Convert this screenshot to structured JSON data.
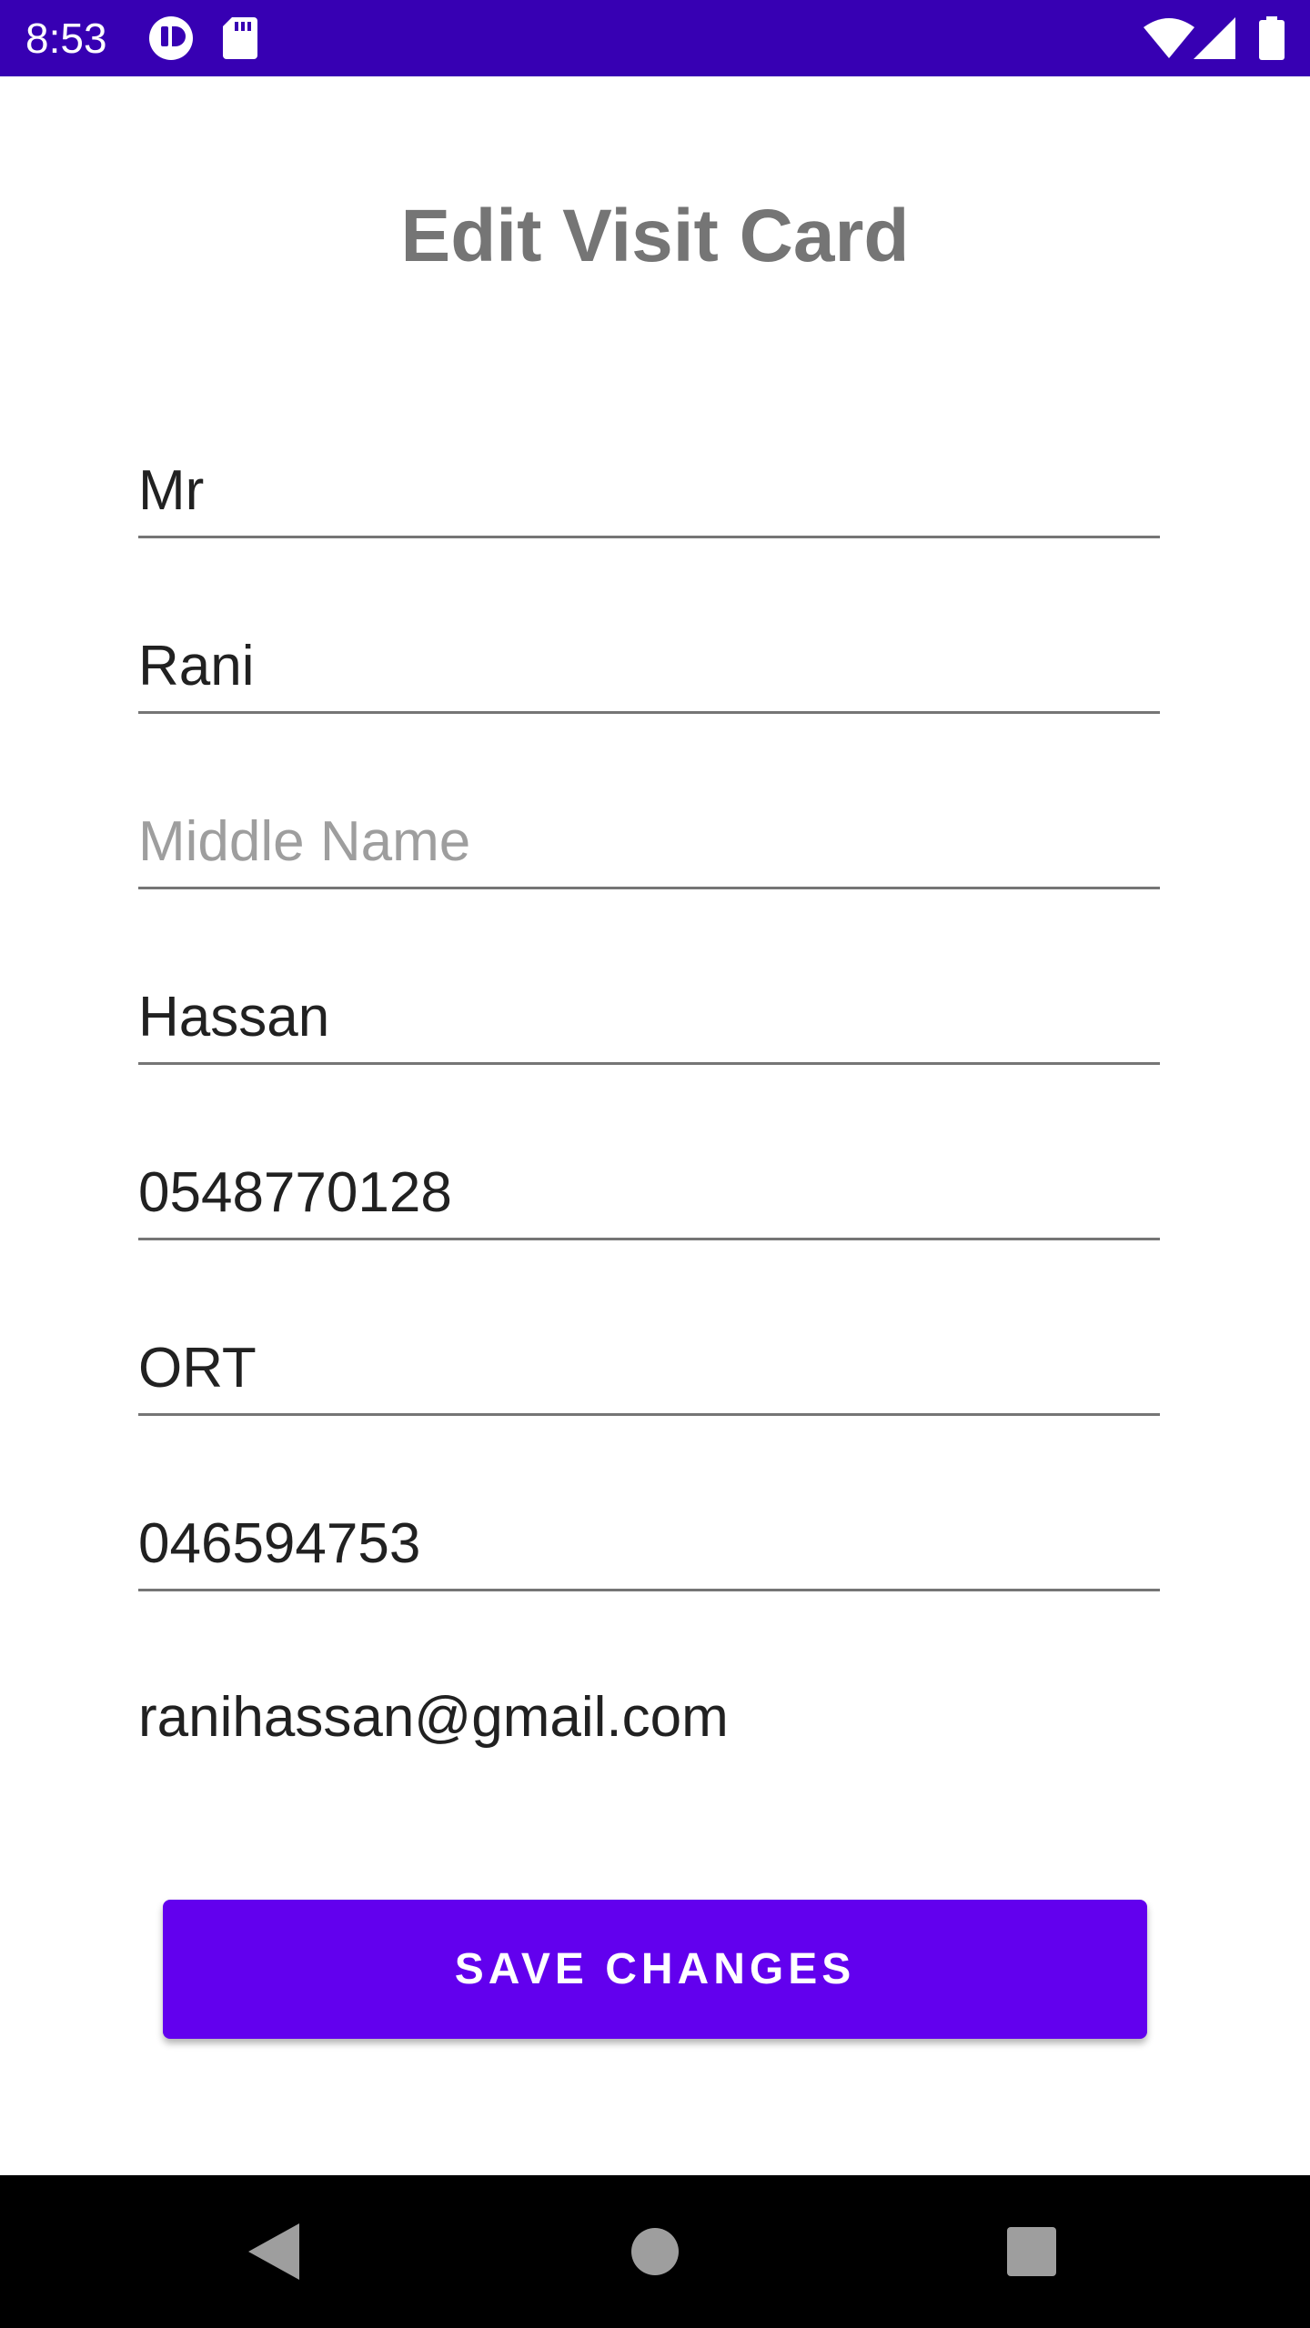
{
  "status_bar": {
    "time": "8:53",
    "background": "#3700b3",
    "icons": [
      "notification-app-icon",
      "sd-card-icon",
      "wifi-icon",
      "signal-icon",
      "battery-icon"
    ]
  },
  "page": {
    "title": "Edit Visit Card"
  },
  "form": {
    "title_value": "Mr",
    "first_name_value": "Rani",
    "middle_name_placeholder": "Middle Name",
    "last_name_value": "Hassan",
    "phone_value": "0548770128",
    "company_value": "ORT",
    "work_phone_value": "046594753",
    "email_value": "ranihassan@gmail.com"
  },
  "save_button": {
    "label": "SAVE CHANGES",
    "color": "#6200ee"
  },
  "nav_bar": {
    "icons": [
      "back-icon",
      "home-icon",
      "recents-icon"
    ]
  }
}
